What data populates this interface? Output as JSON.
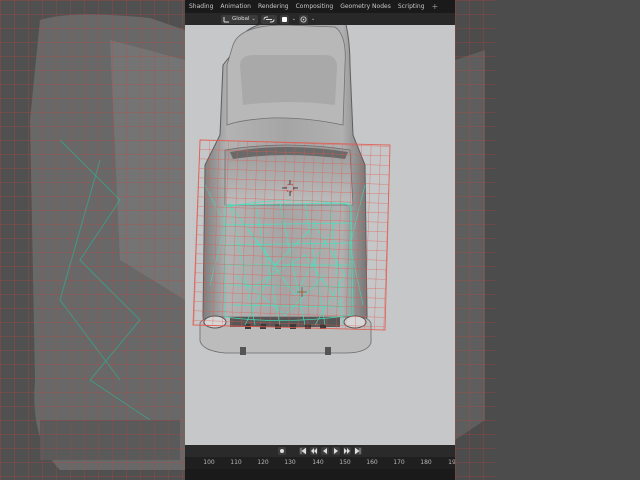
{
  "tabs": [
    "Shading",
    "Animation",
    "Rendering",
    "Compositing",
    "Geometry Nodes",
    "Scripting",
    "+"
  ],
  "toolbar": {
    "orientation_label": "Global"
  },
  "timeline": {
    "frame_ticks": [
      "100",
      "110",
      "120",
      "130",
      "140",
      "150",
      "160",
      "170",
      "180",
      "19"
    ]
  },
  "colors": {
    "grid_lattice": "#e4584d",
    "wire_mesh": "#3fe6c0",
    "viewport_bg": "#c5c7c9"
  }
}
